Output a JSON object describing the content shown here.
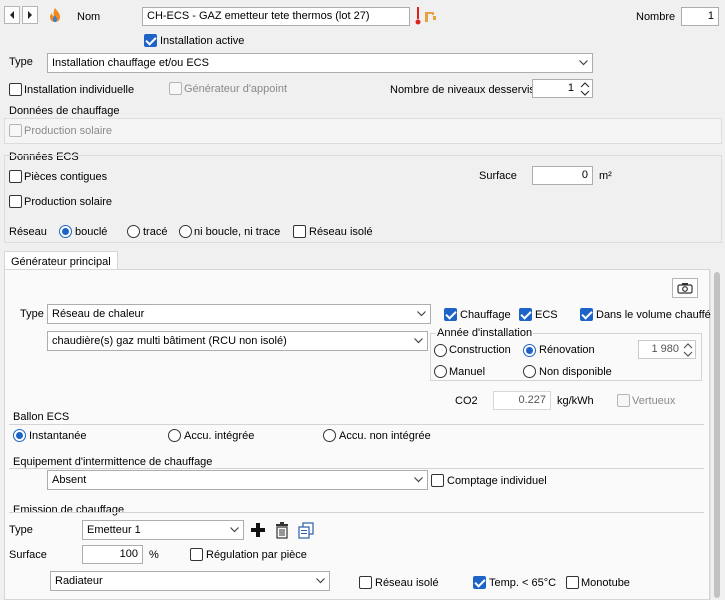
{
  "header": {
    "name_label": "Nom",
    "name_value": "CH-ECS - GAZ emetteur tete thermos (lot 27)",
    "nombre_label": "Nombre",
    "nombre_value": "1",
    "installation_active_label": "Installation active",
    "installation_active_checked": true
  },
  "type_row": {
    "label": "Type",
    "value": "Installation chauffage et/ou ECS"
  },
  "options_row": {
    "individuelle_label": "Installation individuelle",
    "generateur_appoint_label": "Générateur d'appoint",
    "niveaux_label": "Nombre de niveaux desservis",
    "niveaux_value": "1"
  },
  "donnees_chauffage": {
    "title": "Données de chauffage",
    "production_solaire_label": "Production solaire"
  },
  "donnees_ecs": {
    "title": "Données ECS",
    "pieces_contigues_label": "Pièces contigues",
    "production_solaire_label": "Production solaire",
    "surface_label": "Surface",
    "surface_value": "0",
    "surface_unit": "m²",
    "reseau_label": "Réseau",
    "reseau_options": [
      "bouclé",
      "tracé",
      "ni boucle, ni trace"
    ],
    "reseau_selected": "bouclé",
    "reseau_isole_label": "Réseau isolé"
  },
  "generateur": {
    "tab_label": "Générateur principal",
    "type_label": "Type",
    "type_value": "Réseau de chaleur",
    "subtype_value": "chaudière(s) gaz multi bâtiment (RCU non isolé)",
    "chauffage_label": "Chauffage",
    "ecs_label": "ECS",
    "volume_chauffe_label": "Dans le volume chauffé",
    "annee_title": "Année d'installation",
    "construction_label": "Construction",
    "renovation_label": "Rénovation",
    "manuel_label": "Manuel",
    "non_disponible_label": "Non disponible",
    "annee_value": "1 980",
    "co2_label": "CO2",
    "co2_value": "0.227",
    "co2_unit": "kg/kWh",
    "vertueux_label": "Vertueux"
  },
  "ballon_ecs": {
    "title": "Ballon ECS",
    "instantanee_label": "Instantanée",
    "accu_integree_label": "Accu. intégrée",
    "accu_non_integree_label": "Accu. non intégrée"
  },
  "intermittence": {
    "title": "Equipement d'intermittence de chauffage",
    "value": "Absent",
    "comptage_label": "Comptage individuel"
  },
  "emission": {
    "title": "Emission de chauffage",
    "type_label": "Type",
    "type_value": "Emetteur 1",
    "surface_label": "Surface",
    "surface_value": "100",
    "surface_unit": "%",
    "regulation_label": "Régulation par pièce",
    "emetteur_value": "Radiateur",
    "reseau_isole_label": "Réseau isolé",
    "temp_label": "Temp. < 65°C",
    "monotube_label": "Monotube"
  },
  "icons": [
    "chevron-left-icon",
    "chevron-right-icon",
    "flame-icon",
    "thermometer-icon",
    "faucet-icon",
    "camera-icon",
    "plus-icon",
    "trash-icon",
    "copy-icon"
  ],
  "colors": {
    "accent": "#1e64c8",
    "warning_red": "#d9261c",
    "faucet_orange": "#e9a23b"
  }
}
